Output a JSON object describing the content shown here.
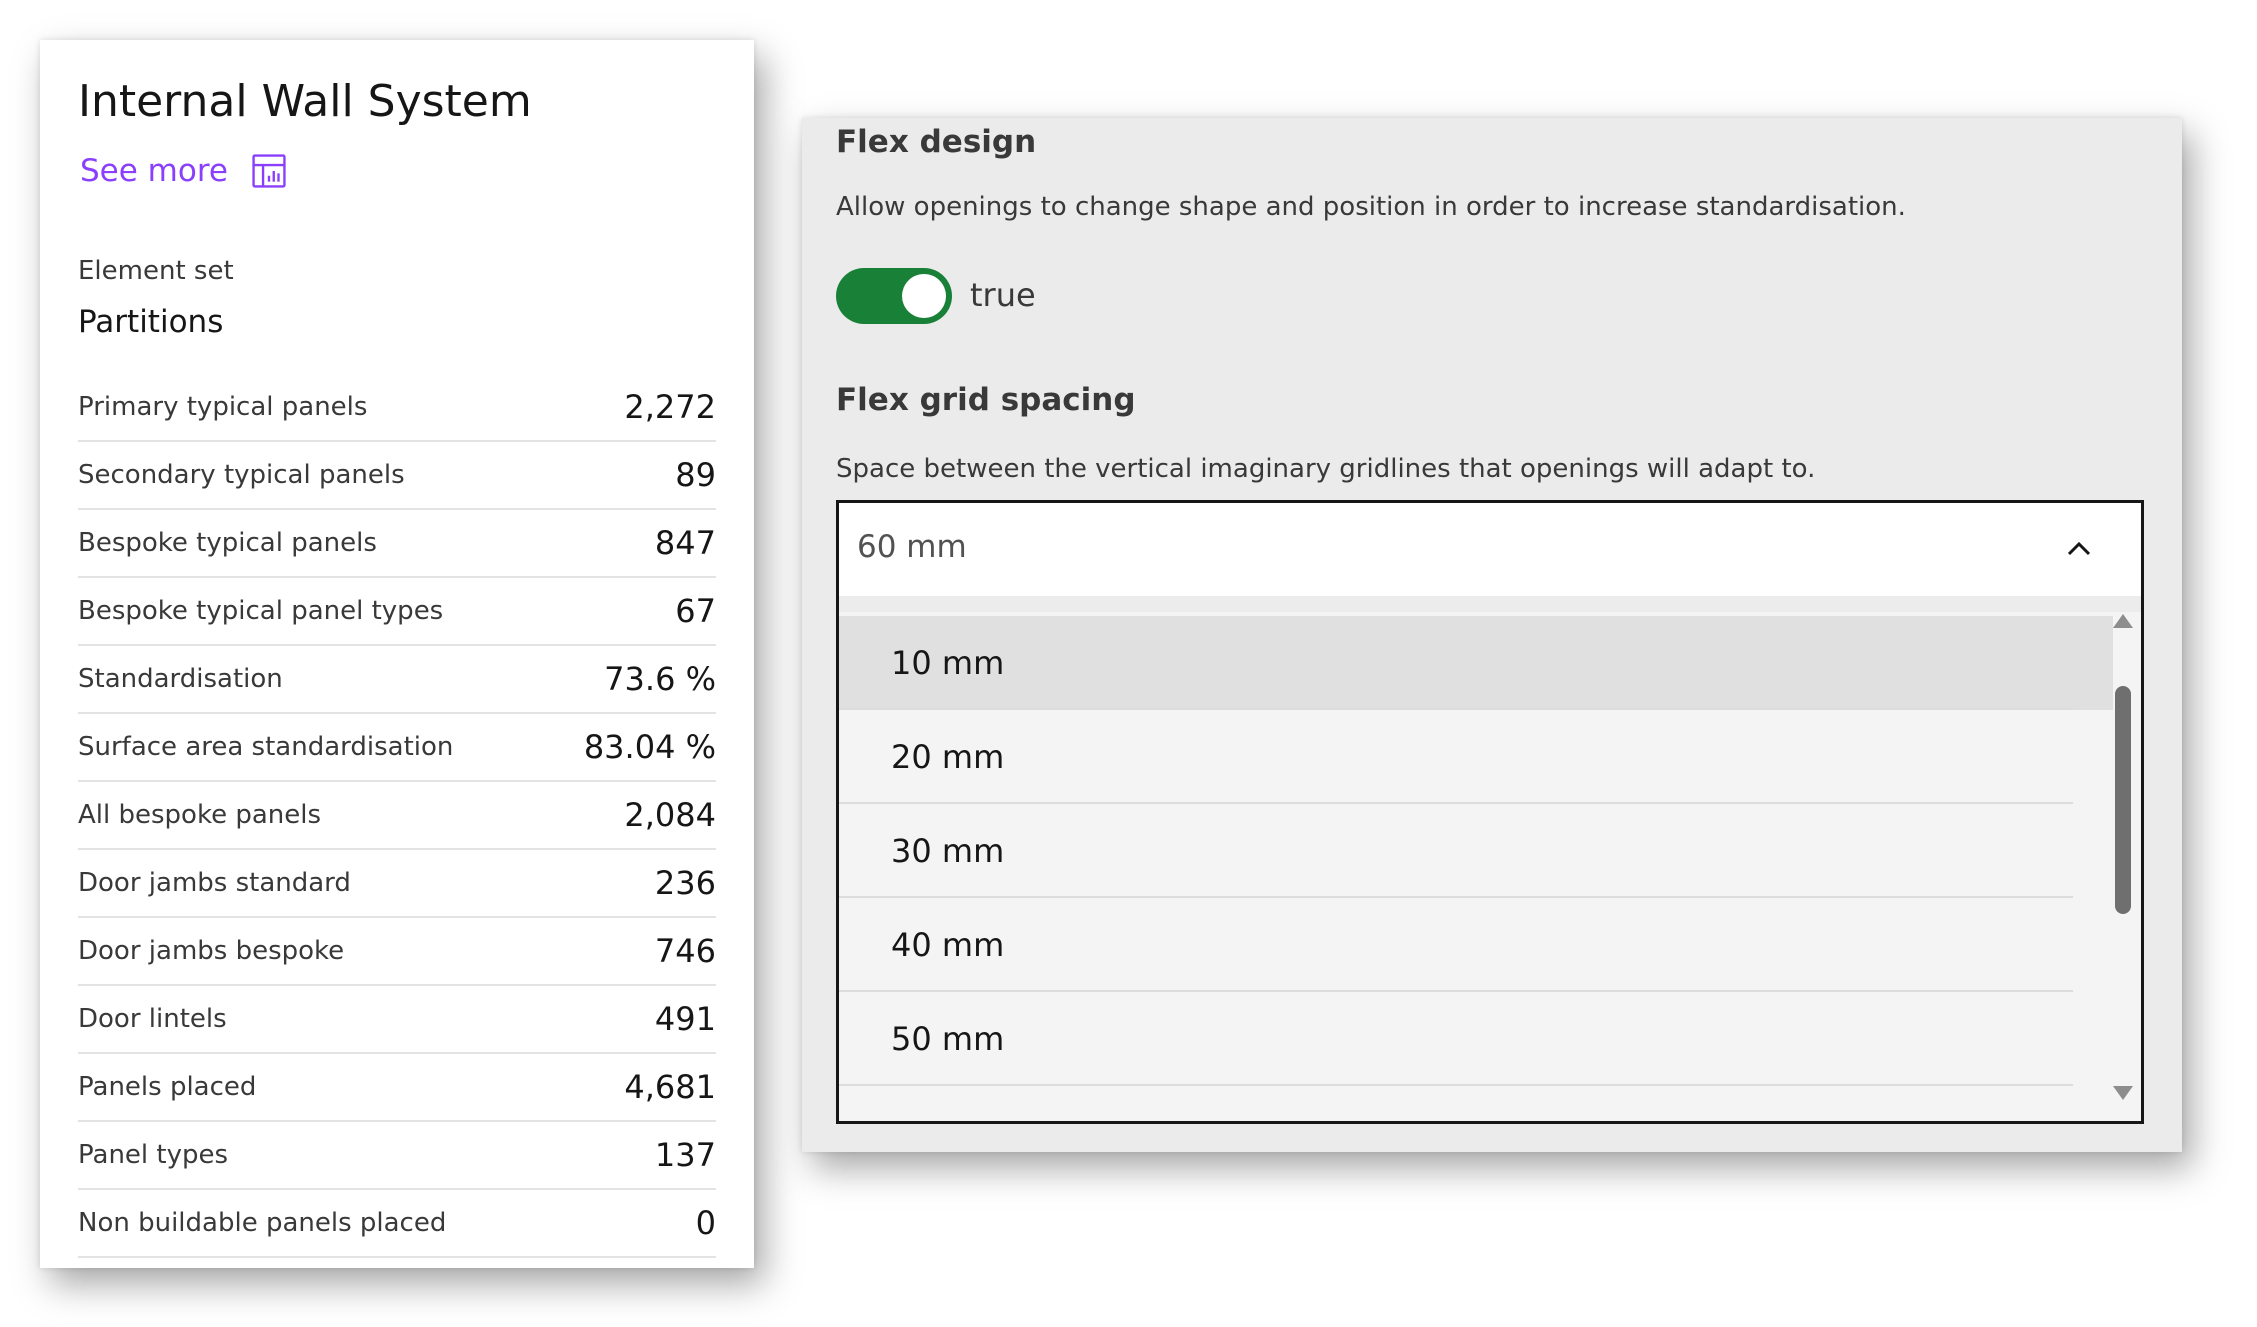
{
  "summary": {
    "title": "Internal Wall System",
    "see_more": "See more",
    "see_more_icon": "report-chart-icon",
    "element_set_label": "Element set",
    "element_set_value": "Partitions",
    "stats": [
      {
        "label": "Primary typical panels",
        "value": "2,272"
      },
      {
        "label": "Secondary typical panels",
        "value": "89"
      },
      {
        "label": "Bespoke typical panels",
        "value": "847"
      },
      {
        "label": "Bespoke typical panel types",
        "value": "67"
      },
      {
        "label": "Standardisation",
        "value": "73.6 %"
      },
      {
        "label": "Surface area standardisation",
        "value": "83.04 %"
      },
      {
        "label": "All bespoke panels",
        "value": "2,084"
      },
      {
        "label": "Door jambs standard",
        "value": "236"
      },
      {
        "label": "Door jambs bespoke",
        "value": "746"
      },
      {
        "label": "Door lintels",
        "value": "491"
      },
      {
        "label": "Panels placed",
        "value": "4,681"
      },
      {
        "label": "Panel types",
        "value": "137"
      },
      {
        "label": "Non buildable panels placed",
        "value": "0"
      }
    ]
  },
  "settings": {
    "flex_design": {
      "title": "Flex design",
      "description": "Allow openings to change shape and position in order to increase standardisation.",
      "toggle_on": true,
      "toggle_text": "true"
    },
    "flex_grid": {
      "title": "Flex grid spacing",
      "description": "Space between the vertical imaginary gridlines that openings will adapt to.",
      "selected": "60 mm",
      "chevron_icon": "chevron-up-icon",
      "options": [
        "10 mm",
        "20 mm",
        "30 mm",
        "40 mm",
        "50 mm"
      ],
      "highlighted_option_index": 0
    }
  },
  "colors": {
    "accent_link": "#8a3ffc",
    "toggle_on": "#198038"
  }
}
